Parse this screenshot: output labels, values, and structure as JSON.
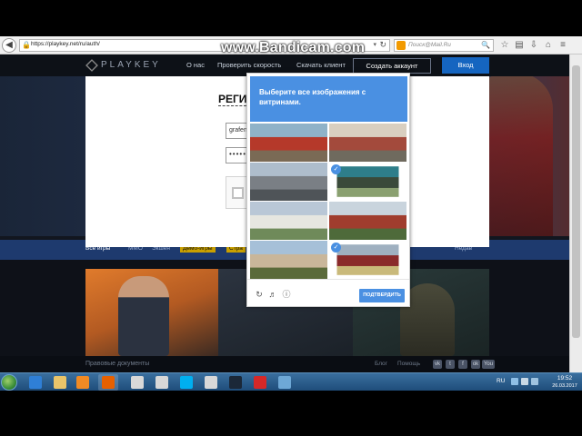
{
  "watermark": "www.Bandicam.com",
  "browser": {
    "url": "https://playkey.net/ru/auth/",
    "search_placeholder": "Поиск@Mail.Ru"
  },
  "site": {
    "logo": "PLAYKEY",
    "nav": [
      "О нас",
      "Проверить скорость",
      "Скачать клиент"
    ],
    "create_account": "Создать аккаунт",
    "login": "Вход",
    "categories": [
      "Все игры",
      "MMO",
      "Экшен",
      "Демо-игры",
      "Стра"
    ],
    "last_tab": "Недав",
    "footer_legal": "Правовые документы",
    "footer_links": [
      "Блог",
      "Помощь"
    ],
    "social": [
      "vk",
      "twitter",
      "fb",
      "ok",
      "youtube"
    ],
    "social_labels": {
      "vk": "vk",
      "twitter": "t",
      "fb": "f",
      "ok": "ok",
      "youtube": "You"
    }
  },
  "registration": {
    "title": "РЕГИ",
    "email_value": "grafen",
    "password_mask": "•••••"
  },
  "captcha": {
    "prompt": "Выберите все изображения с витринами.",
    "verify_label": "ПОДТВЕРДИТЬ",
    "tiles": [
      {
        "selected": false,
        "colors": [
          "#8fb2c8",
          "#b5392a",
          "#7a6a55"
        ]
      },
      {
        "selected": false,
        "colors": [
          "#d9cfc0",
          "#a34a3c",
          "#6f6a5e"
        ]
      },
      {
        "selected": false,
        "colors": [
          "#aebdcc",
          "#7a7f85",
          "#4f5458"
        ]
      },
      {
        "selected": true,
        "colors": [
          "#2e7e8a",
          "#3a4a3a",
          "#8aa070"
        ]
      },
      {
        "selected": false,
        "colors": [
          "#b9c7d6",
          "#e6e6e0",
          "#6f8a5a"
        ]
      },
      {
        "selected": false,
        "colors": [
          "#c9d4dd",
          "#a03d2e",
          "#4e6a3a"
        ]
      },
      {
        "selected": false,
        "colors": [
          "#a6c0d8",
          "#c9b69a",
          "#5a6a3a"
        ]
      },
      {
        "selected": true,
        "colors": [
          "#9fb0c0",
          "#8a2a2a",
          "#c9b97a"
        ]
      },
      {
        "selected": false,
        "colors": [
          "#ffffff",
          "#ffffff",
          "#ffffff"
        ]
      }
    ]
  },
  "taskbar": {
    "apps": [
      {
        "name": "ie-icon",
        "color": "#2f7fd6"
      },
      {
        "name": "folder-icon",
        "color": "#e9c46a"
      },
      {
        "name": "media-icon",
        "color": "#f08a24"
      },
      {
        "name": "firefox-icon",
        "color": "#e66000"
      },
      {
        "name": "calc-icon-1",
        "color": "#d8d8d8"
      },
      {
        "name": "calc-icon-2",
        "color": "#d8d8d8"
      },
      {
        "name": "skype-icon",
        "color": "#00aff0"
      },
      {
        "name": "calc-icon-3",
        "color": "#d8d8d8"
      },
      {
        "name": "steam-icon",
        "color": "#1b2838"
      },
      {
        "name": "record-icon",
        "color": "#d62828"
      },
      {
        "name": "window-icon",
        "color": "#6ea8d6"
      }
    ],
    "lang": "RU",
    "time": "19:52",
    "date": "26.03.2017"
  }
}
